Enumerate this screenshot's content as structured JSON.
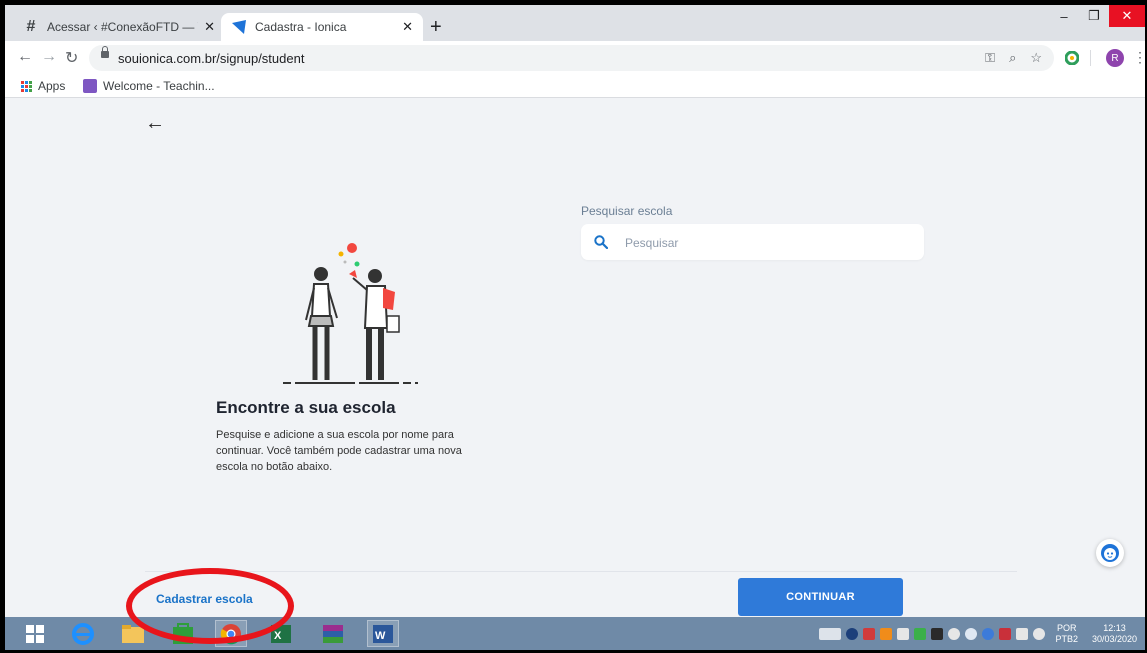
{
  "browser": {
    "tabs": [
      {
        "label": "Acessar ‹ #ConexãoFTD — Word",
        "active": false
      },
      {
        "label": "Cadastra - Ionica",
        "active": true
      }
    ],
    "url": "souionica.com.br/signup/student",
    "profile_initial": "R"
  },
  "bookmarks": [
    {
      "label": "Apps",
      "icon": "apps-grid-icon"
    },
    {
      "label": "Welcome - Teachin...",
      "icon": "bookmark-favicon"
    }
  ],
  "page": {
    "search": {
      "label": "Pesquisar escola",
      "placeholder": "Pesquisar"
    },
    "heading": "Encontre a sua escola",
    "description": "Pesquise e adicione a sua escola por nome para continuar. Você também pode cadastrar uma nova escola no botão abaixo.",
    "register_link": "Cadastrar escola",
    "continue_button": "CONTINUAR"
  },
  "taskbar": {
    "language": "POR",
    "keyboard": "PTB2",
    "time": "12:13",
    "date": "30/03/2020"
  },
  "colors": {
    "accent": "#2f7ad9",
    "link": "#1a73c8",
    "annotation": "#e8151b",
    "taskbar": "#6f8aa7"
  }
}
